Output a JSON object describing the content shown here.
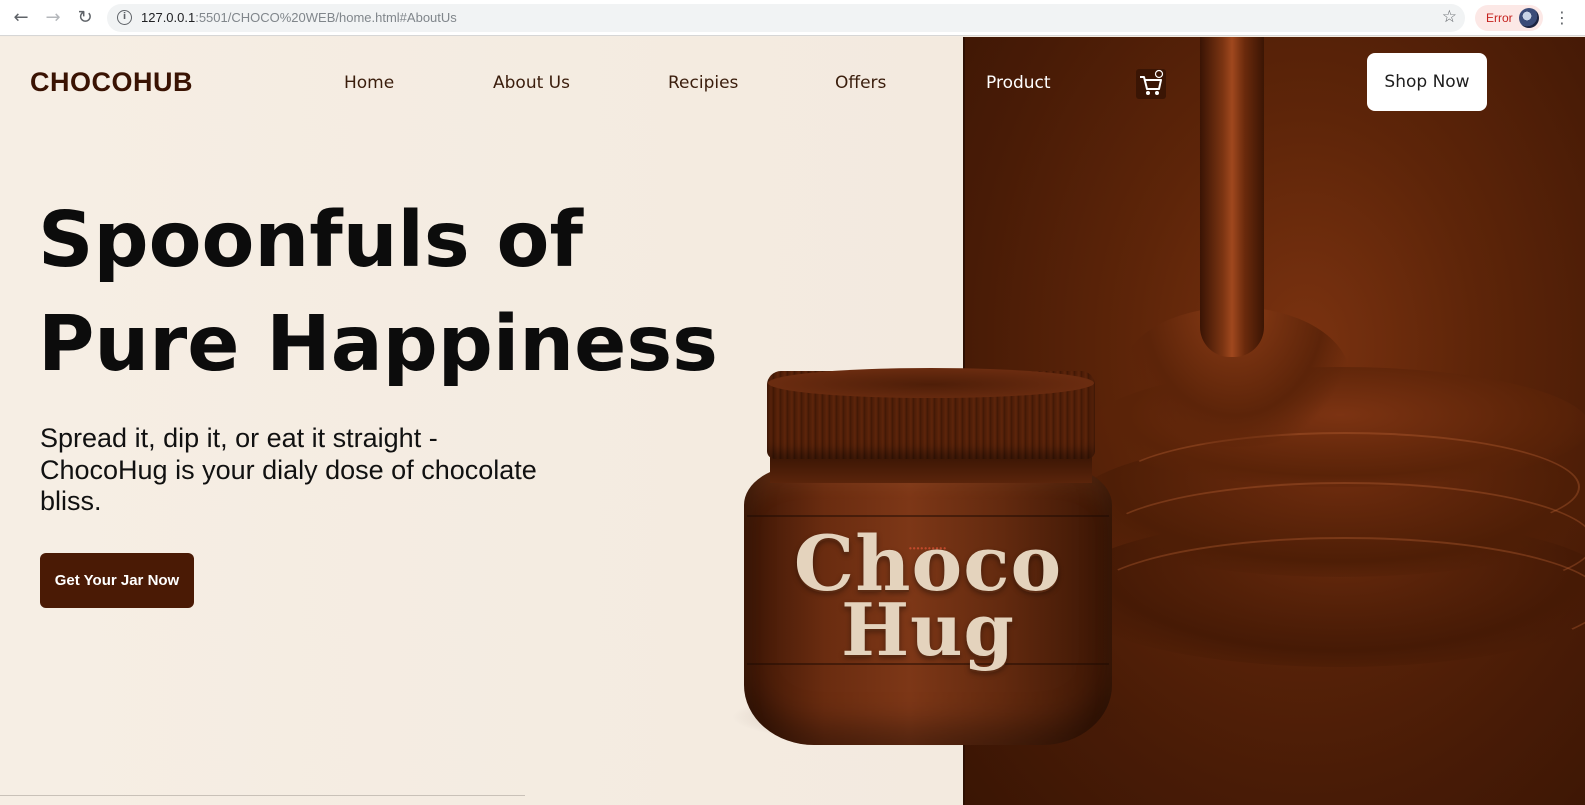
{
  "browser": {
    "url_host": "127.0.0.1",
    "url_rest": ":5501/CHOCO%20WEB/home.html#AboutUs",
    "error_label": "Error",
    "back_icon": "back-arrow-icon",
    "forward_icon": "forward-arrow-icon",
    "reload_icon": "reload-icon",
    "info_icon": "site-info-icon",
    "bookmark_icon": "star-icon",
    "menu_icon": "kebab-menu-icon"
  },
  "nav": {
    "logo": "CHOCOHUB",
    "links": [
      "Home",
      "About Us",
      "Recipies",
      "Offers",
      "Product"
    ],
    "cart_icon": "cart-icon",
    "shop_button": "Shop Now"
  },
  "hero": {
    "title_line1": "Spoonfuls of",
    "title_line2": "Pure Happiness",
    "subtitle": "Spread it, dip it, or eat it straight - ChocoHug is your dialy dose of chocolate bliss.",
    "cta": "Get Your Jar Now"
  },
  "jar": {
    "brand_line1": "Choco",
    "brand_line2": "Hug"
  },
  "colors": {
    "brand_dark": "#3a1303",
    "cta_bg": "#4a1a05",
    "page_bg": "#f4ece2",
    "chocolate_panel": "#5e2509"
  }
}
